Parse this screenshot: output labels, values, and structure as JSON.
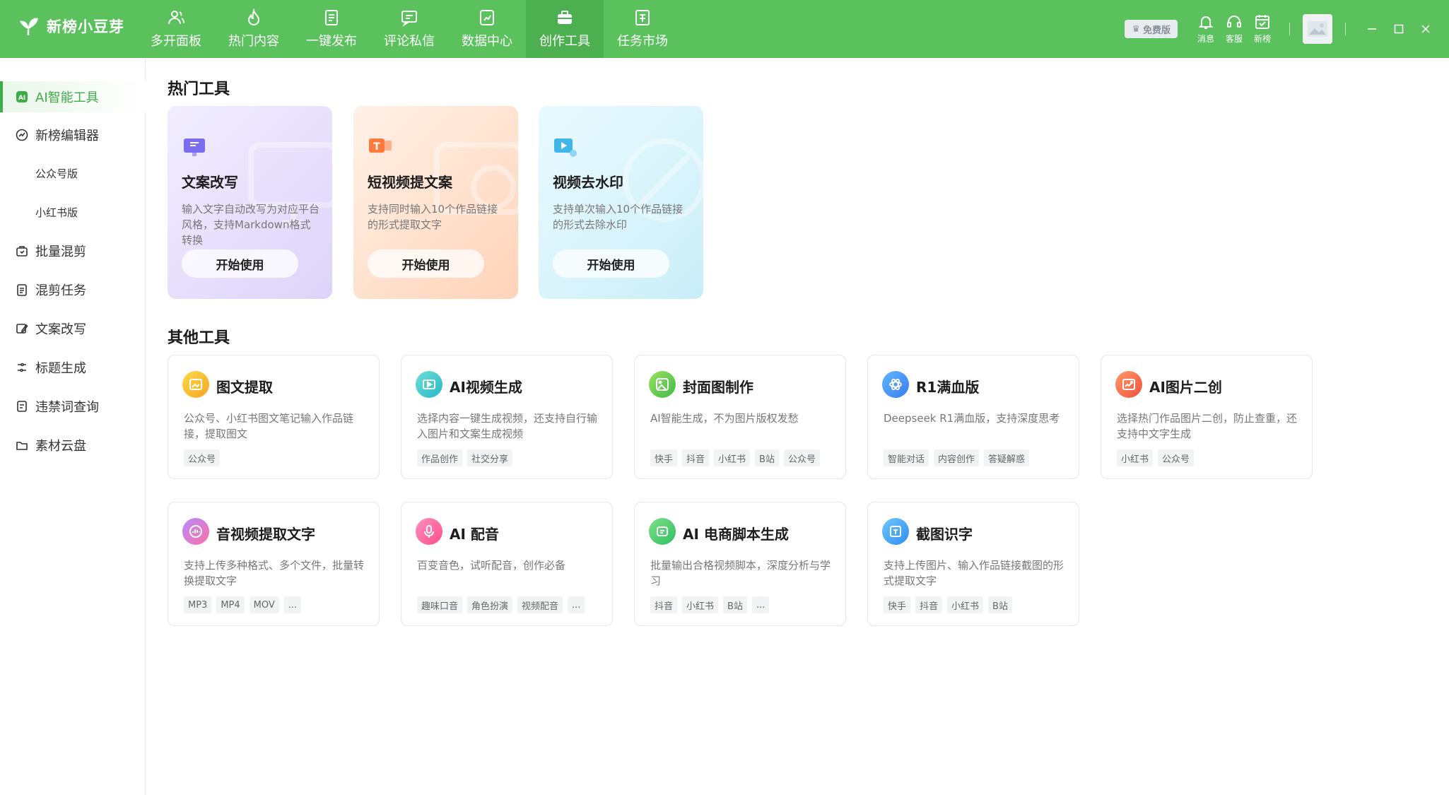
{
  "app": {
    "name": "新榜小豆芽"
  },
  "nav": [
    {
      "label": "多开面板",
      "icon": "people-icon"
    },
    {
      "label": "热门内容",
      "icon": "flame-icon"
    },
    {
      "label": "一键发布",
      "icon": "publish-icon"
    },
    {
      "label": "评论私信",
      "icon": "comment-icon"
    },
    {
      "label": "数据中心",
      "icon": "data-icon"
    },
    {
      "label": "创作工具",
      "icon": "toolbox-icon",
      "active": true
    },
    {
      "label": "任务市场",
      "icon": "task-icon"
    }
  ],
  "topright": {
    "vip_label": "免费版",
    "message_label": "消息",
    "service_label": "客服",
    "newrank_label": "新榜"
  },
  "sidebar": {
    "items": [
      {
        "label": "AI智能工具",
        "icon": "ai-icon",
        "active": true
      },
      {
        "label": "新榜编辑器",
        "icon": "editor-icon"
      },
      {
        "label": "公众号版",
        "sub": true
      },
      {
        "label": "小红书版",
        "sub": true
      },
      {
        "label": "批量混剪",
        "icon": "mix-icon"
      },
      {
        "label": "混剪任务",
        "icon": "task-list-icon"
      },
      {
        "label": "文案改写",
        "icon": "rewrite-icon"
      },
      {
        "label": "标题生成",
        "icon": "title-icon"
      },
      {
        "label": "违禁词查询",
        "icon": "forbidden-icon"
      },
      {
        "label": "素材云盘",
        "icon": "folder-icon"
      }
    ]
  },
  "hot_tools": {
    "title": "热门工具",
    "cards": [
      {
        "title": "文案改写",
        "desc": "输入文字自动改写为对应平台风格，支持Markdown格式转换",
        "button": "开始使用"
      },
      {
        "title": "短视频提文案",
        "desc": "支持同时输入10个作品链接的形式提取文字",
        "button": "开始使用"
      },
      {
        "title": "视频去水印",
        "desc": "支持单次输入10个作品链接的形式去除水印",
        "button": "开始使用"
      }
    ]
  },
  "other_tools": {
    "title": "其他工具",
    "cards": [
      {
        "title": "图文提取",
        "desc": "公众号、小红书图文笔记输入作品链接，提取图文",
        "tags": [
          "公众号"
        ]
      },
      {
        "title": "AI视频生成",
        "desc": "选择内容一键生成视频，还支持自行输入图片和文案生成视频",
        "tags": [
          "作品创作",
          "社交分享"
        ]
      },
      {
        "title": "封面图制作",
        "desc": "AI智能生成，不为图片版权发愁",
        "tags": [
          "快手",
          "抖音",
          "小红书",
          "B站",
          "公众号"
        ]
      },
      {
        "title": "R1满血版",
        "desc": "Deepseek R1满血版，支持深度思考",
        "tags": [
          "智能对话",
          "内容创作",
          "答疑解惑"
        ]
      },
      {
        "title": "AI图片二创",
        "desc": "选择热门作品图片二创，防止查重，还支持中文字生成",
        "tags": [
          "小红书",
          "公众号"
        ]
      },
      {
        "title": "音视频提取文字",
        "desc": "支持上传多种格式、多个文件，批量转换提取文字",
        "tags": [
          "MP3",
          "MP4",
          "MOV",
          "..."
        ]
      },
      {
        "title": "AI 配音",
        "desc": "百变音色，试听配音，创作必备",
        "tags": [
          "趣味口音",
          "角色扮演",
          "视频配音",
          "..."
        ]
      },
      {
        "title": "AI 电商脚本生成",
        "desc": "批量输出合格视频脚本，深度分析与学习",
        "tags": [
          "抖音",
          "小红书",
          "B站",
          "..."
        ]
      },
      {
        "title": "截图识字",
        "desc": "支持上传图片、输入作品链接截图的形式提取文字",
        "tags": [
          "快手",
          "抖音",
          "小红书",
          "B站"
        ]
      }
    ]
  },
  "colors": {
    "brand": "#5ac15d",
    "brand_active": "#4caf50",
    "sidebar_active": "#3dae47"
  }
}
